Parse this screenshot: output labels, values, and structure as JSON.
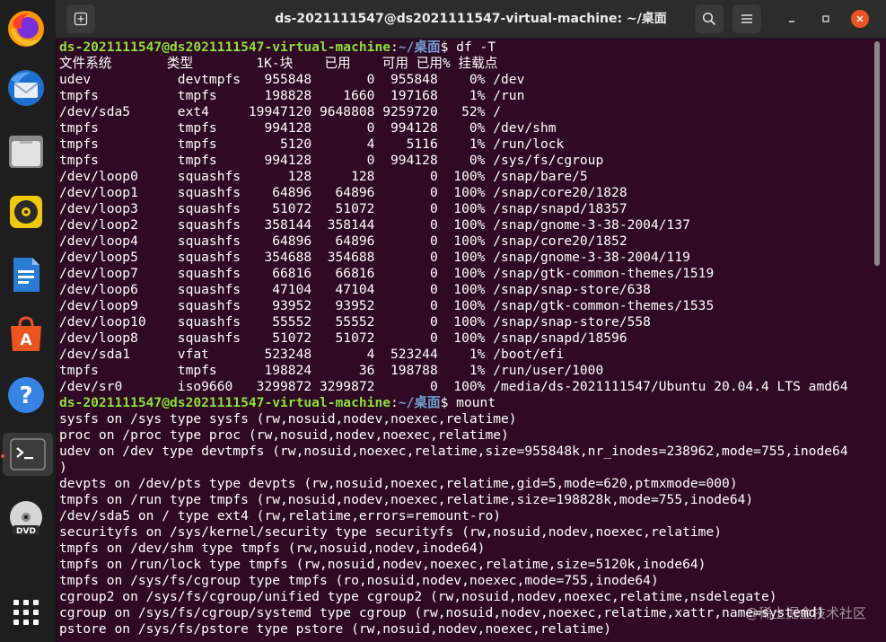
{
  "window": {
    "title": "ds-2021111547@ds2021111547-virtual-machine: ~/桌面"
  },
  "dock": {
    "items": [
      {
        "name": "firefox-icon"
      },
      {
        "name": "thunderbird-icon"
      },
      {
        "name": "files-icon"
      },
      {
        "name": "rhythmbox-icon"
      },
      {
        "name": "libreoffice-writer-icon"
      },
      {
        "name": "software-center-icon"
      },
      {
        "name": "help-icon"
      },
      {
        "name": "terminal-icon"
      },
      {
        "name": "dvd-icon"
      },
      {
        "name": "show-apps-icon"
      }
    ]
  },
  "prompt": {
    "user": "ds-2021111547@ds2021111547-virtual-machine",
    "path": "~/桌面"
  },
  "terminal_lines": [
    {
      "type": "prompt",
      "cmd": " df -T"
    },
    {
      "type": "out",
      "text": "文件系统       类型        1K-块    已用    可用 已用% 挂载点"
    },
    {
      "type": "out",
      "text": "udev           devtmpfs   955848       0  955848    0% /dev"
    },
    {
      "type": "out",
      "text": "tmpfs          tmpfs      198828    1660  197168    1% /run"
    },
    {
      "type": "out",
      "text": "/dev/sda5      ext4     19947120 9648808 9259720   52% /"
    },
    {
      "type": "out",
      "text": "tmpfs          tmpfs      994128       0  994128    0% /dev/shm"
    },
    {
      "type": "out",
      "text": "tmpfs          tmpfs        5120       4    5116    1% /run/lock"
    },
    {
      "type": "out",
      "text": "tmpfs          tmpfs      994128       0  994128    0% /sys/fs/cgroup"
    },
    {
      "type": "out",
      "text": "/dev/loop0     squashfs      128     128       0  100% /snap/bare/5"
    },
    {
      "type": "out",
      "text": "/dev/loop1     squashfs    64896   64896       0  100% /snap/core20/1828"
    },
    {
      "type": "out",
      "text": "/dev/loop3     squashfs    51072   51072       0  100% /snap/snapd/18357"
    },
    {
      "type": "out",
      "text": "/dev/loop2     squashfs   358144  358144       0  100% /snap/gnome-3-38-2004/137"
    },
    {
      "type": "out",
      "text": "/dev/loop4     squashfs    64896   64896       0  100% /snap/core20/1852"
    },
    {
      "type": "out",
      "text": "/dev/loop5     squashfs   354688  354688       0  100% /snap/gnome-3-38-2004/119"
    },
    {
      "type": "out",
      "text": "/dev/loop7     squashfs    66816   66816       0  100% /snap/gtk-common-themes/1519"
    },
    {
      "type": "out",
      "text": "/dev/loop6     squashfs    47104   47104       0  100% /snap/snap-store/638"
    },
    {
      "type": "out",
      "text": "/dev/loop9     squashfs    93952   93952       0  100% /snap/gtk-common-themes/1535"
    },
    {
      "type": "out",
      "text": "/dev/loop10    squashfs    55552   55552       0  100% /snap/snap-store/558"
    },
    {
      "type": "out",
      "text": "/dev/loop8     squashfs    51072   51072       0  100% /snap/snapd/18596"
    },
    {
      "type": "out",
      "text": "/dev/sda1      vfat       523248       4  523244    1% /boot/efi"
    },
    {
      "type": "out",
      "text": "tmpfs          tmpfs      198824      36  198788    1% /run/user/1000"
    },
    {
      "type": "out",
      "text": "/dev/sr0       iso9660   3299872 3299872       0  100% /media/ds-2021111547/Ubuntu 20.04.4 LTS amd64"
    },
    {
      "type": "prompt",
      "cmd": " mount"
    },
    {
      "type": "out",
      "text": "sysfs on /sys type sysfs (rw,nosuid,nodev,noexec,relatime)"
    },
    {
      "type": "out",
      "text": "proc on /proc type proc (rw,nosuid,nodev,noexec,relatime)"
    },
    {
      "type": "out",
      "text": "udev on /dev type devtmpfs (rw,nosuid,noexec,relatime,size=955848k,nr_inodes=238962,mode=755,inode64"
    },
    {
      "type": "out",
      "text": ")"
    },
    {
      "type": "out",
      "text": "devpts on /dev/pts type devpts (rw,nosuid,noexec,relatime,gid=5,mode=620,ptmxmode=000)"
    },
    {
      "type": "out",
      "text": "tmpfs on /run type tmpfs (rw,nosuid,nodev,noexec,relatime,size=198828k,mode=755,inode64)"
    },
    {
      "type": "out",
      "text": "/dev/sda5 on / type ext4 (rw,relatime,errors=remount-ro)"
    },
    {
      "type": "out",
      "text": "securityfs on /sys/kernel/security type securityfs (rw,nosuid,nodev,noexec,relatime)"
    },
    {
      "type": "out",
      "text": "tmpfs on /dev/shm type tmpfs (rw,nosuid,nodev,inode64)"
    },
    {
      "type": "out",
      "text": "tmpfs on /run/lock type tmpfs (rw,nosuid,nodev,noexec,relatime,size=5120k,inode64)"
    },
    {
      "type": "out",
      "text": "tmpfs on /sys/fs/cgroup type tmpfs (ro,nosuid,nodev,noexec,mode=755,inode64)"
    },
    {
      "type": "out",
      "text": "cgroup2 on /sys/fs/cgroup/unified type cgroup2 (rw,nosuid,nodev,noexec,relatime,nsdelegate)"
    },
    {
      "type": "out",
      "text": "cgroup on /sys/fs/cgroup/systemd type cgroup (rw,nosuid,nodev,noexec,relatime,xattr,name=systemd)"
    },
    {
      "type": "out",
      "text": "pstore on /sys/fs/pstore type pstore (rw,nosuid,nodev,noexec,relatime)"
    }
  ],
  "watermark": "@稀土掘金技术社区",
  "colors": {
    "terminal_bg": "#300a24",
    "prompt_user": "#8ae234",
    "prompt_path": "#729fcf"
  }
}
